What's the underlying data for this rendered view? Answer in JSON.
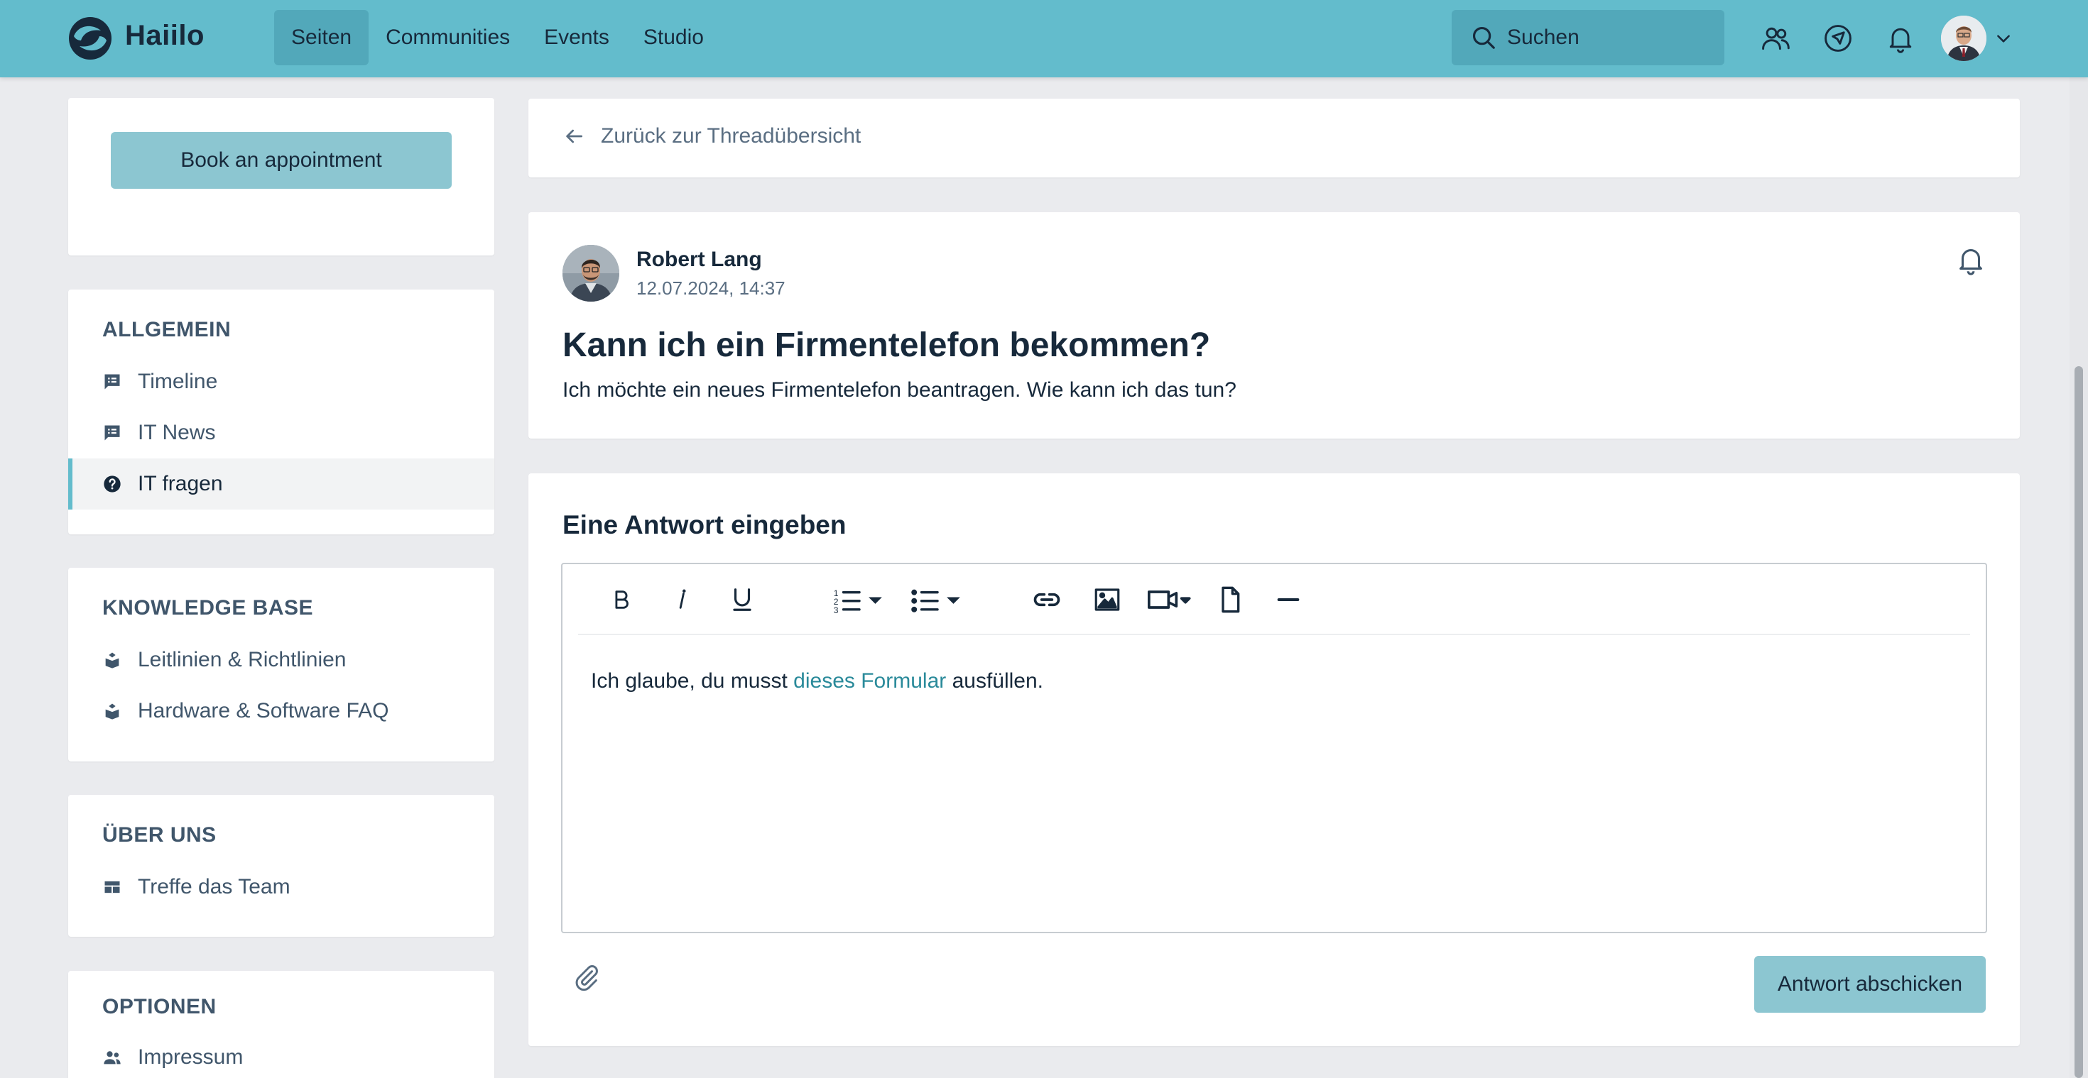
{
  "app": {
    "brand": "Haiilo",
    "accent_color": "#63bccc",
    "button_color": "#8cc6d1"
  },
  "nav": {
    "items": [
      {
        "label": "Seiten",
        "active": true
      },
      {
        "label": "Communities",
        "active": false
      },
      {
        "label": "Events",
        "active": false
      },
      {
        "label": "Studio",
        "active": false
      }
    ],
    "search_label": "Suchen",
    "icons": [
      "people-icon",
      "compass-icon",
      "bell-icon",
      "user-avatar",
      "chevron-down-icon"
    ]
  },
  "sidebar": {
    "book_button": "Book an appointment",
    "sections": [
      {
        "heading": "ALLGEMEIN",
        "items": [
          {
            "label": "Timeline",
            "icon": "comment-list-icon",
            "active": false
          },
          {
            "label": "IT News",
            "icon": "comment-list-icon",
            "active": false
          },
          {
            "label": "IT fragen",
            "icon": "question-circle-icon",
            "active": true
          }
        ]
      },
      {
        "heading": "KNOWLEDGE BASE",
        "items": [
          {
            "label": "Leitlinien & Richtlinien",
            "icon": "book-stack-icon",
            "active": false
          },
          {
            "label": "Hardware & Software FAQ",
            "icon": "book-stack-icon",
            "active": false
          }
        ]
      },
      {
        "heading": "ÜBER UNS",
        "items": [
          {
            "label": "Treffe das Team",
            "icon": "table-icon",
            "active": false
          }
        ]
      },
      {
        "heading": "OPTIONEN",
        "items": [
          {
            "label": "Impressum",
            "icon": "people-icon",
            "active": false
          }
        ]
      }
    ]
  },
  "main": {
    "back_link": "Zurück zur Threadübersicht",
    "post": {
      "author": "Robert Lang",
      "date": "12.07.2024, 14:37",
      "title": "Kann ich ein Firmentelefon bekommen?",
      "body": "Ich möchte ein neues Firmentelefon beantragen. Wie kann ich das tun?"
    },
    "reply": {
      "heading": "Eine Antwort eingeben",
      "text_before": "Ich glaube, du musst ",
      "link_text": "dieses Formular",
      "text_after": " ausfüllen.",
      "link_color": "#2a8a9a",
      "submit_label": "Antwort abschicken",
      "toolbar": [
        "bold-icon",
        "italic-icon",
        "underline-icon",
        "ordered-list-icon",
        "bullet-list-icon",
        "link-icon",
        "image-icon",
        "video-icon",
        "file-icon",
        "horizontal-rule-icon"
      ]
    }
  }
}
